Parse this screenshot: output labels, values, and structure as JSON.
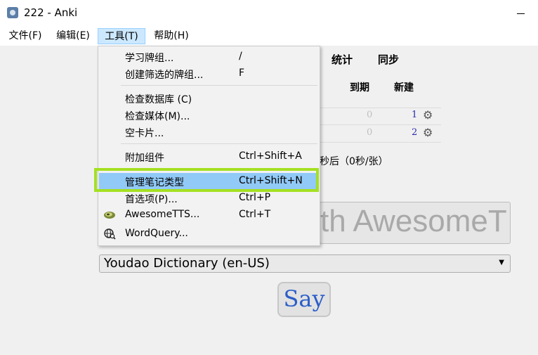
{
  "window": {
    "title": "222 - Anki"
  },
  "menubar": [
    {
      "label": "文件(F)"
    },
    {
      "label": "编辑(E)"
    },
    {
      "label": "工具(T)"
    },
    {
      "label": "帮助(H)"
    }
  ],
  "toolbar": {
    "stats": "统计",
    "sync": "同步"
  },
  "deck_table": {
    "headers": {
      "due": "到期",
      "new": "新建"
    },
    "rows": [
      {
        "due": "0",
        "new": "1"
      },
      {
        "due": "0",
        "new": "2"
      }
    ]
  },
  "study_info": "秒后（0秒/张）",
  "tts": {
    "text": "th AwesomeT",
    "dictionary": "Youdao Dictionary (en-US)",
    "say_label": "Say"
  },
  "tools_menu": {
    "items": [
      {
        "label": "学习牌组...",
        "shortcut": "/"
      },
      {
        "label": "创建筛选的牌组...",
        "shortcut": "F"
      },
      {
        "label": "检查数据库 (C)",
        "shortcut": ""
      },
      {
        "label": "检查媒体(M)...",
        "shortcut": ""
      },
      {
        "label": "空卡片...",
        "shortcut": ""
      },
      {
        "label": "附加组件",
        "shortcut": "Ctrl+Shift+A"
      },
      {
        "label": "管理笔记类型",
        "shortcut": "Ctrl+Shift+N"
      },
      {
        "label": "首选项(P)...",
        "shortcut": "Ctrl+P"
      },
      {
        "label": "AwesomeTTS...",
        "shortcut": "Ctrl+T"
      },
      {
        "label": "WordQuery...",
        "shortcut": ""
      }
    ]
  },
  "colors": {
    "highlight": "#91c9f7",
    "annotation": "#a5e022",
    "menu_active": "#cce8ff"
  }
}
